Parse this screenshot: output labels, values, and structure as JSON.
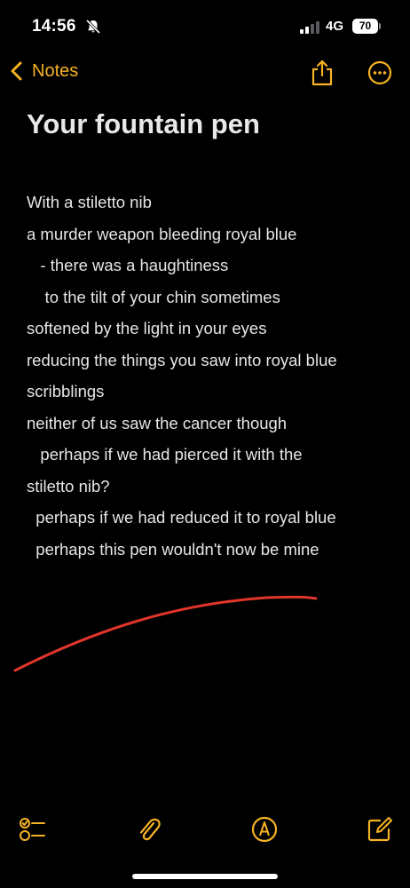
{
  "status_bar": {
    "time": "14:56",
    "network": "4G",
    "battery_percent": "70",
    "icons": [
      "bell-slash-icon",
      "signal-icon",
      "battery-icon"
    ]
  },
  "nav": {
    "back_label": "Notes",
    "icons": [
      "chevron-left-icon",
      "share-icon",
      "more-icon"
    ]
  },
  "note": {
    "title": "Your fountain pen",
    "lines": [
      "With a stiletto nib",
      "a murder weapon bleeding royal blue",
      "   - there was a haughtiness",
      "    to the tilt of your chin sometimes",
      "softened by the light in your eyes",
      "reducing the things you saw into royal blue",
      "scribblings",
      "neither of us saw the cancer though",
      "   perhaps if we had pierced it with the",
      "stiletto nib?",
      "  perhaps if we had reduced it to royal blue",
      "  perhaps this pen wouldn't now be mine"
    ]
  },
  "toolbar": {
    "icons": [
      "checklist-icon",
      "paperclip-icon",
      "markup-pen-icon",
      "compose-icon"
    ]
  },
  "colors": {
    "accent": "#f5b324",
    "background": "#000000",
    "text": "#e6e6e6",
    "sketch_stroke": "#e0352b"
  }
}
